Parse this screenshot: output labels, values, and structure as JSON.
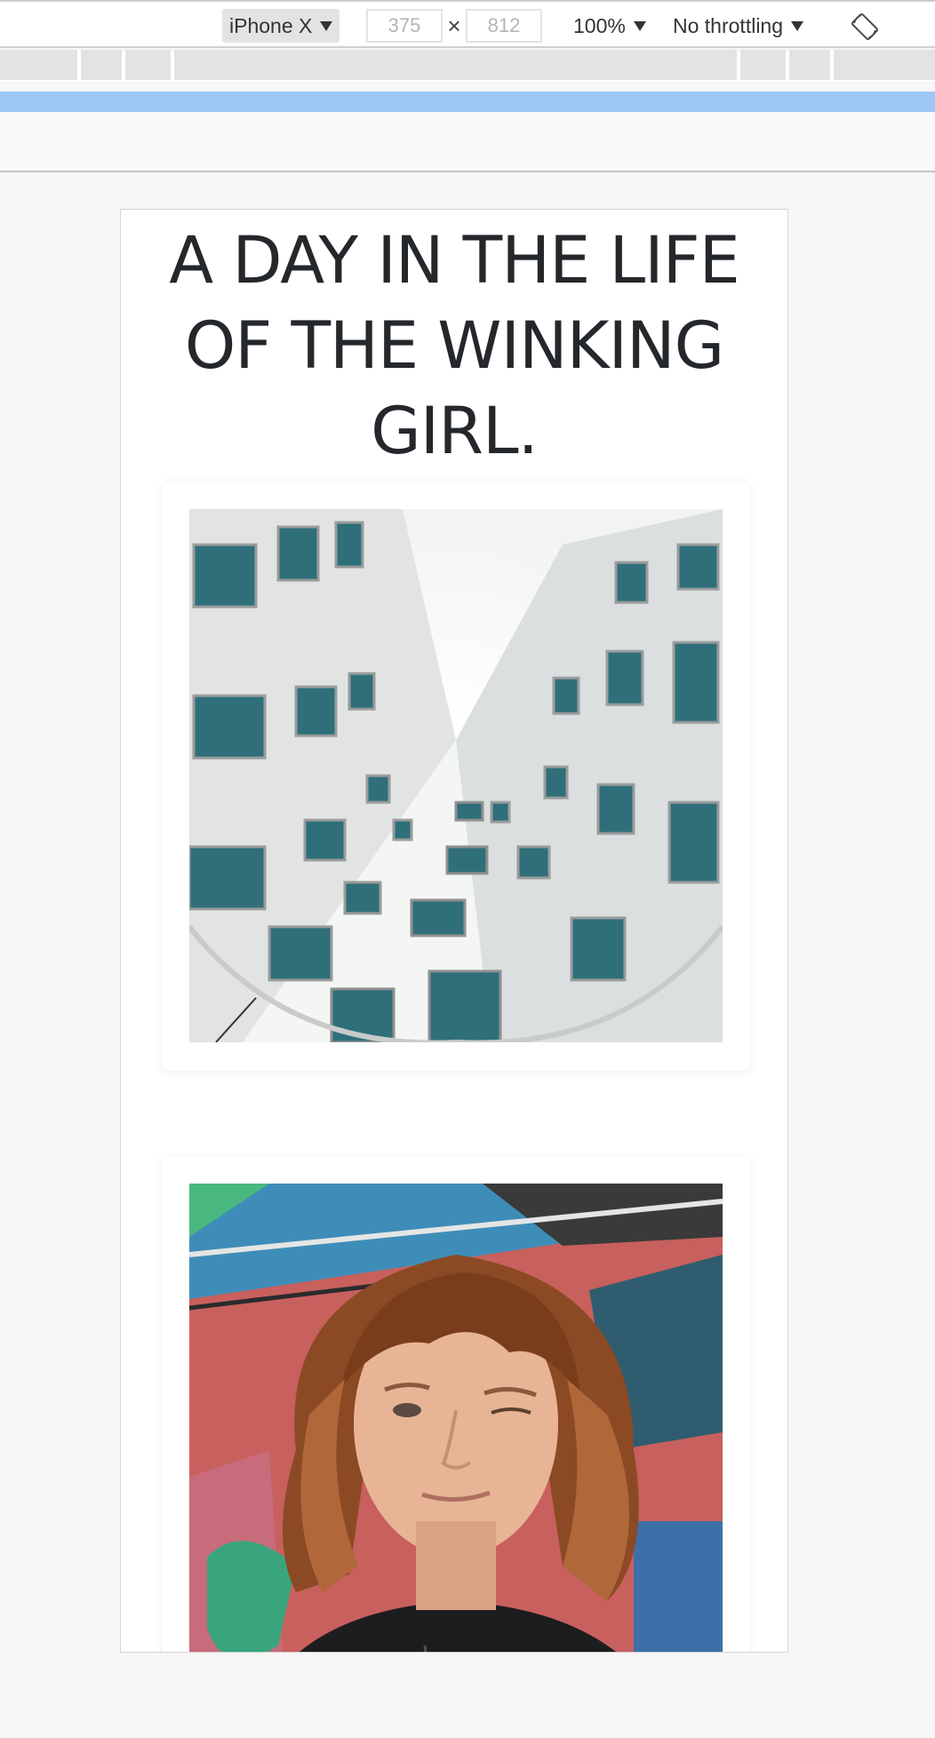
{
  "toolbar": {
    "device": "iPhone X",
    "width_value": "375",
    "height_value": "812",
    "dimension_separator": "×",
    "zoom": "100%",
    "throttling": "No throttling",
    "rotate_icon": "rotate-device-icon",
    "dropdown_icon": "caret-down-icon"
  },
  "breakpoints": {
    "bar_color": "#e3e3e3",
    "media_query_color": "#9dc8f5"
  },
  "page": {
    "title_lines": [
      "A DAY IN THE LIFE",
      "OF THE WINKING",
      "GIRL."
    ],
    "title_color": "#24272b",
    "images": [
      {
        "subject": "upward view of modern building facade with rows of teal windows"
      },
      {
        "subject": "girl with curly auburn hair winking in front of graffiti wall"
      }
    ]
  }
}
